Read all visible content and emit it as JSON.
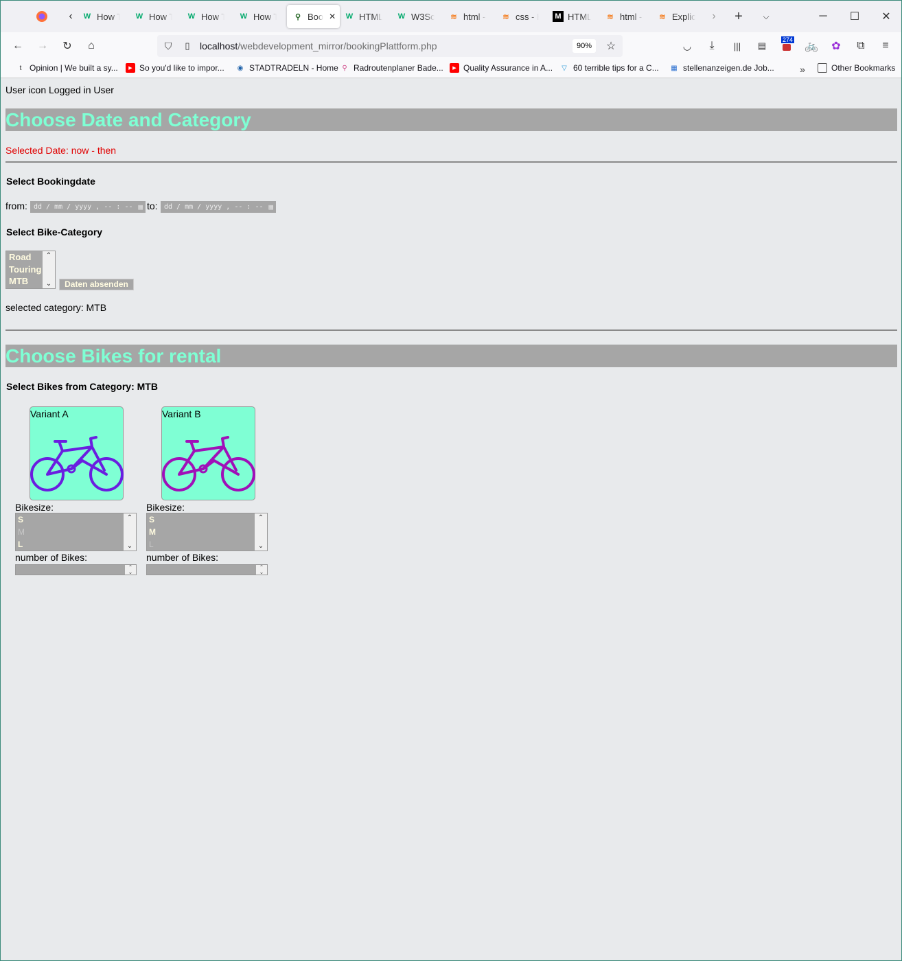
{
  "browser": {
    "tabs": [
      {
        "title": "How T",
        "icon": "w3schools-icon"
      },
      {
        "title": "How T",
        "icon": "w3schools-icon"
      },
      {
        "title": "How T",
        "icon": "w3schools-icon"
      },
      {
        "title": "How T",
        "icon": "w3schools-icon"
      },
      {
        "title": "Boo",
        "icon": "bike-icon",
        "active": true
      },
      {
        "title": "HTML",
        "icon": "w3schools-icon"
      },
      {
        "title": "W3Sc",
        "icon": "w3schools-icon"
      },
      {
        "title": "html -",
        "icon": "stackoverflow-icon"
      },
      {
        "title": "css - H",
        "icon": "stackoverflow-icon"
      },
      {
        "title": "HTML",
        "icon": "mdn-icon"
      },
      {
        "title": "html -",
        "icon": "stackoverflow-icon"
      },
      {
        "title": "Explic",
        "icon": "stackoverflow-icon"
      }
    ],
    "url_host": "localhost",
    "url_path": "/webdevelopment_mirror/bookingPlattform.php",
    "zoom": "90%",
    "ext_badge": "274",
    "bookmarks": [
      {
        "label": "Opinion | We built a sy...",
        "icon": "tagesspiegel-icon"
      },
      {
        "label": "So you'd like to impor...",
        "icon": "youtube-icon"
      },
      {
        "label": "STADTRADELN - Home",
        "icon": "stadtradeln-icon"
      },
      {
        "label": "Radroutenplaner Bade...",
        "icon": "bike-icon"
      },
      {
        "label": "Quality Assurance in A...",
        "icon": "youtube-icon"
      },
      {
        "label": "60 terrible tips for a C...",
        "icon": "pvs-icon"
      },
      {
        "label": "stellenanzeigen.de Job...",
        "icon": "stellenanzeigen-icon"
      }
    ],
    "other_bookmarks": "Other Bookmarks"
  },
  "page": {
    "user_line": "User icon Logged in User",
    "section1_title": "Choose Date and Category",
    "selected_date": "Selected Date: now - then",
    "bookingdate_heading": "Select Bookingdate",
    "from_label": "from:",
    "to_label": "to:",
    "date_placeholder": "dd / mm / yyyy ,  -- : --",
    "category_heading": "Select Bike-Category",
    "categories": [
      "Road",
      "Touring",
      "MTB"
    ],
    "submit_label": "Daten absenden",
    "selected_category": "selected category: MTB",
    "section2_title": "Choose Bikes for rental",
    "bikes_heading": "Select Bikes from Category: MTB",
    "bikes": [
      {
        "variant": "Variant A",
        "color": "#6a1ee0",
        "size_label": "Bikesize:",
        "sizes": [
          "S",
          "M",
          "L"
        ],
        "disabled": [
          "M"
        ],
        "number_label": "number of Bikes:"
      },
      {
        "variant": "Variant B",
        "color": "#a010b8",
        "size_label": "Bikesize:",
        "sizes": [
          "S",
          "M",
          "L"
        ],
        "disabled": [
          "L"
        ],
        "number_label": "number of Bikes:"
      }
    ],
    "heading_color": "#7fffd4",
    "date_color": "#e00000"
  }
}
